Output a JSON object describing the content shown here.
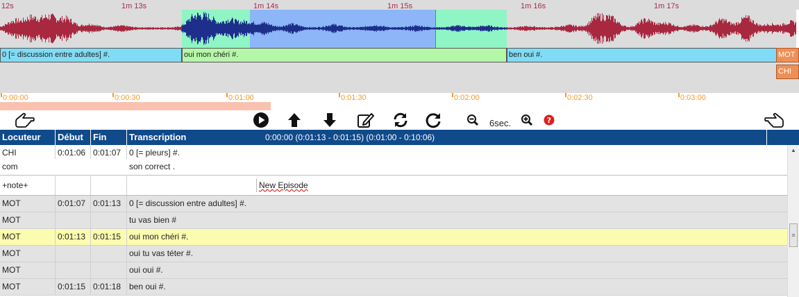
{
  "waveform": {
    "ticks": [
      "12s",
      "1m 13s",
      "1m 14s",
      "1m 15s",
      "1m 16s",
      "1m 17s"
    ],
    "segments": [
      "0 [= discussion entre adultes]  #.",
      "oui mon chéri  #.",
      "ben oui  #."
    ],
    "speaker_labels": [
      "MOT",
      "CHI"
    ],
    "colors": {
      "wave_red": "#a8283f",
      "wave_blue": "#1d2f8a",
      "region_green": "#8ff5c4",
      "region_blue": "#8cb6f7"
    }
  },
  "timeline": {
    "ticks": [
      "0:00:00",
      "0:00:30",
      "0:01:00",
      "0:01:30",
      "0:02:00",
      "0:02:30",
      "0:03:00"
    ],
    "color": "#f39a2a"
  },
  "toolbar": {
    "icons": [
      "hand-left-icon",
      "play-icon",
      "arrow-up-icon",
      "arrow-down-icon",
      "edit-icon",
      "loop-icon",
      "redo-icon",
      "zoom-out-icon",
      "zoom-in-icon",
      "help-icon",
      "hand-right-icon"
    ],
    "duration": "6sec."
  },
  "table": {
    "headers": [
      "Locuteur",
      "Début",
      "Fin",
      "Transcription"
    ],
    "header_info": "0:00:00 (0:01:13 - 0:01:15)  (0:01:00 - 0:10:06)",
    "header_color": "#0f4a8a",
    "rows": [
      {
        "speaker": "CHI",
        "start": "0:01:06",
        "end": "0:01:07",
        "text": "0 [= pleurs] #."
      },
      {
        "speaker": " com",
        "start": "",
        "end": "",
        "text": "son correct ."
      },
      {
        "speaker": "+note+",
        "start": "",
        "end": "",
        "text": "New Episode"
      },
      {
        "speaker": "MOT",
        "start": "0:01:07",
        "end": "0:01:13",
        "text": "0 [= discussion entre adultes] #."
      },
      {
        "speaker": "MOT",
        "start": "",
        "end": "",
        "text": "tu vas bien #"
      },
      {
        "speaker": "MOT",
        "start": "0:01:13",
        "end": "0:01:15",
        "text": "oui mon chéri #."
      },
      {
        "speaker": "MOT",
        "start": "",
        "end": "",
        "text": "oui tu vas téter #."
      },
      {
        "speaker": "MOT",
        "start": "",
        "end": "",
        "text": "oui oui #."
      },
      {
        "speaker": "MOT",
        "start": "0:01:15",
        "end": "0:01:18",
        "text": "ben oui #."
      }
    ]
  }
}
